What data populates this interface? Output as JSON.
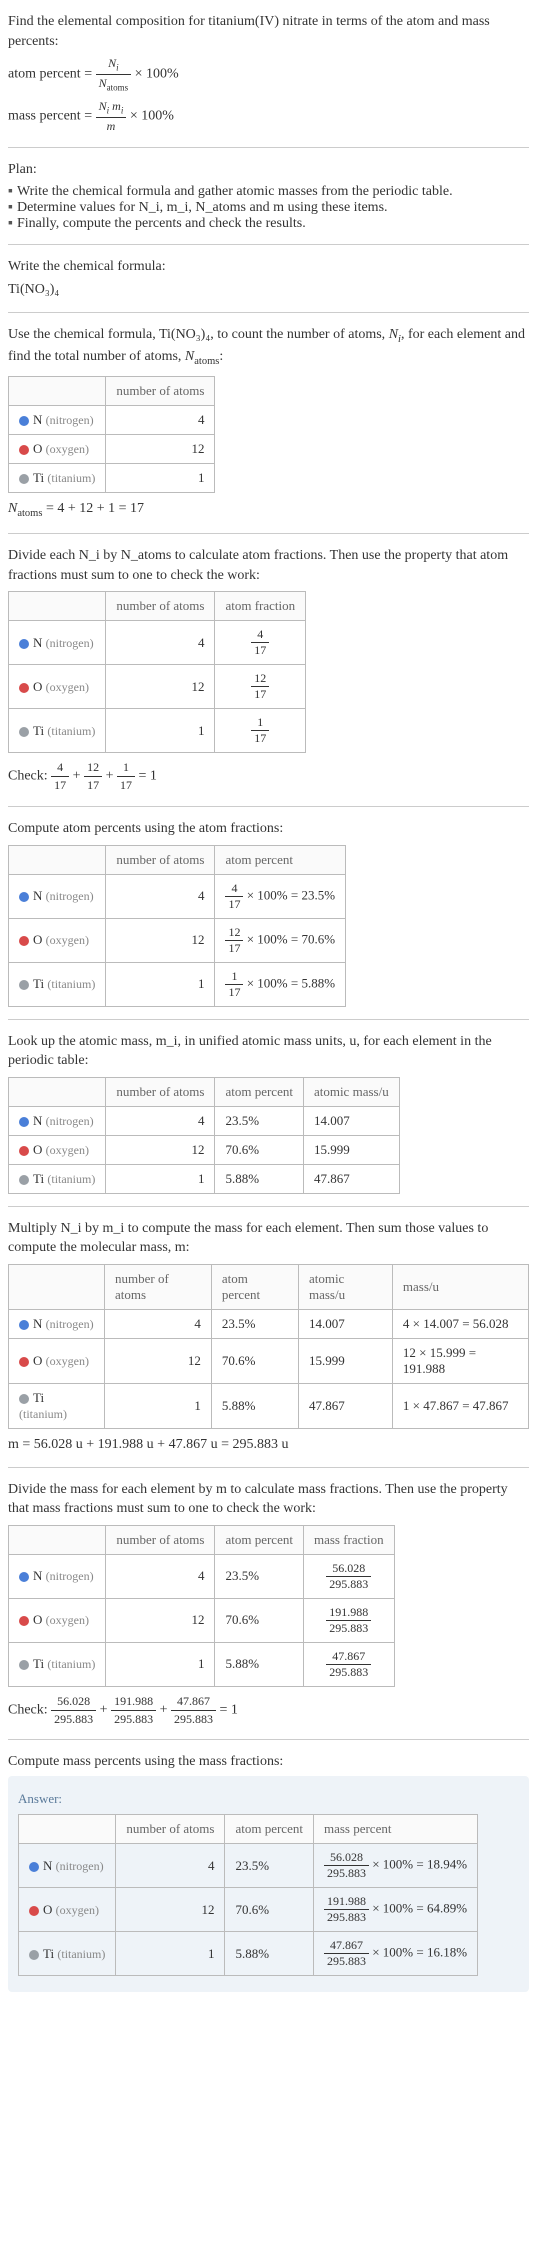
{
  "intro": {
    "title": "Find the elemental composition for titanium(IV) nitrate in terms of the atom and mass percents:",
    "atom_percent_label": "atom percent",
    "atom_percent_formula_num": "N_i",
    "atom_percent_formula_den": "N_atoms",
    "times100": " × 100%",
    "mass_percent_label": "mass percent",
    "mass_percent_formula_num": "N_i m_i",
    "mass_percent_formula_den": "m"
  },
  "plan": {
    "heading": "Plan:",
    "items": [
      "Write the chemical formula and gather atomic masses from the periodic table.",
      "Determine values for N_i, m_i, N_atoms and m using these items.",
      "Finally, compute the percents and check the results."
    ]
  },
  "formula_sec": {
    "heading": "Write the chemical formula:",
    "formula": "Ti(NO₃)₄"
  },
  "count_sec": {
    "intro_a": "Use the chemical formula, Ti(NO₃)₄, to count the number of atoms, ",
    "intro_b": ", for each element and find the total number of atoms, ",
    "intro_c": ":",
    "headers": [
      "",
      "number of atoms"
    ],
    "rows": [
      {
        "el": "N",
        "name": "(nitrogen)",
        "dot": "blue",
        "n": "4"
      },
      {
        "el": "O",
        "name": "(oxygen)",
        "dot": "red",
        "n": "12"
      },
      {
        "el": "Ti",
        "name": "(titanium)",
        "dot": "gray",
        "n": "1"
      }
    ],
    "natoms_eq": "N_atoms = 4 + 12 + 1 = 17"
  },
  "frac_sec": {
    "intro": "Divide each N_i by N_atoms to calculate atom fractions. Then use the property that atom fractions must sum to one to check the work:",
    "headers": [
      "",
      "number of atoms",
      "atom fraction"
    ],
    "rows": [
      {
        "el": "N",
        "name": "(nitrogen)",
        "dot": "blue",
        "n": "4",
        "frac_num": "4",
        "frac_den": "17"
      },
      {
        "el": "O",
        "name": "(oxygen)",
        "dot": "red",
        "n": "12",
        "frac_num": "12",
        "frac_den": "17"
      },
      {
        "el": "Ti",
        "name": "(titanium)",
        "dot": "gray",
        "n": "1",
        "frac_num": "1",
        "frac_den": "17"
      }
    ],
    "check_label": "Check: ",
    "check_terms": [
      "4",
      "12",
      "1"
    ],
    "check_den": "17",
    "check_eq": " = 1"
  },
  "atom_pct_sec": {
    "intro": "Compute atom percents using the atom fractions:",
    "headers": [
      "",
      "number of atoms",
      "atom percent"
    ],
    "rows": [
      {
        "el": "N",
        "name": "(nitrogen)",
        "dot": "blue",
        "n": "4",
        "frac_num": "4",
        "frac_den": "17",
        "pct": " × 100% = 23.5%"
      },
      {
        "el": "O",
        "name": "(oxygen)",
        "dot": "red",
        "n": "12",
        "frac_num": "12",
        "frac_den": "17",
        "pct": " × 100% = 70.6%"
      },
      {
        "el": "Ti",
        "name": "(titanium)",
        "dot": "gray",
        "n": "1",
        "frac_num": "1",
        "frac_den": "17",
        "pct": " × 100% = 5.88%"
      }
    ]
  },
  "atomic_mass_sec": {
    "intro": "Look up the atomic mass, m_i, in unified atomic mass units, u, for each element in the periodic table:",
    "headers": [
      "",
      "number of atoms",
      "atom percent",
      "atomic mass/u"
    ],
    "rows": [
      {
        "el": "N",
        "name": "(nitrogen)",
        "dot": "blue",
        "n": "4",
        "pct": "23.5%",
        "mass": "14.007"
      },
      {
        "el": "O",
        "name": "(oxygen)",
        "dot": "red",
        "n": "12",
        "pct": "70.6%",
        "mass": "15.999"
      },
      {
        "el": "Ti",
        "name": "(titanium)",
        "dot": "gray",
        "n": "1",
        "pct": "5.88%",
        "mass": "47.867"
      }
    ]
  },
  "mass_sec": {
    "intro": "Multiply N_i by m_i to compute the mass for each element. Then sum those values to compute the molecular mass, m:",
    "headers": [
      "",
      "number of atoms",
      "atom percent",
      "atomic mass/u",
      "mass/u"
    ],
    "rows": [
      {
        "el": "N",
        "name": "(nitrogen)",
        "dot": "blue",
        "n": "4",
        "pct": "23.5%",
        "mass": "14.007",
        "calc": "4 × 14.007 = 56.028"
      },
      {
        "el": "O",
        "name": "(oxygen)",
        "dot": "red",
        "n": "12",
        "pct": "70.6%",
        "mass": "15.999",
        "calc": "12 × 15.999 = 191.988"
      },
      {
        "el": "Ti",
        "name": "(titanium)",
        "dot": "gray",
        "n": "1",
        "pct": "5.88%",
        "mass": "47.867",
        "calc": "1 × 47.867 = 47.867"
      }
    ],
    "m_eq": "m = 56.028 u + 191.988 u + 47.867 u = 295.883 u"
  },
  "mass_frac_sec": {
    "intro": "Divide the mass for each element by m to calculate mass fractions. Then use the property that mass fractions must sum to one to check the work:",
    "headers": [
      "",
      "number of atoms",
      "atom percent",
      "mass fraction"
    ],
    "rows": [
      {
        "el": "N",
        "name": "(nitrogen)",
        "dot": "blue",
        "n": "4",
        "pct": "23.5%",
        "frac_num": "56.028",
        "frac_den": "295.883"
      },
      {
        "el": "O",
        "name": "(oxygen)",
        "dot": "red",
        "n": "12",
        "pct": "70.6%",
        "frac_num": "191.988",
        "frac_den": "295.883"
      },
      {
        "el": "Ti",
        "name": "(titanium)",
        "dot": "gray",
        "n": "1",
        "pct": "5.88%",
        "frac_num": "47.867",
        "frac_den": "295.883"
      }
    ],
    "check_label": "Check: ",
    "check_terms": [
      "56.028",
      "191.988",
      "47.867"
    ],
    "check_den": "295.883",
    "check_eq": " = 1"
  },
  "mass_pct_sec": {
    "intro": "Compute mass percents using the mass fractions:",
    "answer_label": "Answer:",
    "headers": [
      "",
      "number of atoms",
      "atom percent",
      "mass percent"
    ],
    "rows": [
      {
        "el": "N",
        "name": "(nitrogen)",
        "dot": "blue",
        "n": "4",
        "pct": "23.5%",
        "frac_num": "56.028",
        "frac_den": "295.883",
        "result": " × 100% = 18.94%"
      },
      {
        "el": "O",
        "name": "(oxygen)",
        "dot": "red",
        "n": "12",
        "pct": "70.6%",
        "frac_num": "191.988",
        "frac_den": "295.883",
        "result": " × 100% = 64.89%"
      },
      {
        "el": "Ti",
        "name": "(titanium)",
        "dot": "gray",
        "n": "1",
        "pct": "5.88%",
        "frac_num": "47.867",
        "frac_den": "295.883",
        "result": " × 100% = 16.18%"
      }
    ]
  },
  "chart_data": {
    "type": "table",
    "title": "Elemental composition of Ti(NO3)4",
    "elements": [
      "N",
      "O",
      "Ti"
    ],
    "number_of_atoms": [
      4,
      12,
      1
    ],
    "atom_fraction": [
      "4/17",
      "12/17",
      "1/17"
    ],
    "atom_percent": [
      23.5,
      70.6,
      5.88
    ],
    "atomic_mass_u": [
      14.007,
      15.999,
      47.867
    ],
    "element_mass_u": [
      56.028,
      191.988,
      47.867
    ],
    "molecular_mass_u": 295.883,
    "mass_fraction": [
      "56.028/295.883",
      "191.988/295.883",
      "47.867/295.883"
    ],
    "mass_percent": [
      18.94,
      64.89,
      16.18
    ]
  }
}
